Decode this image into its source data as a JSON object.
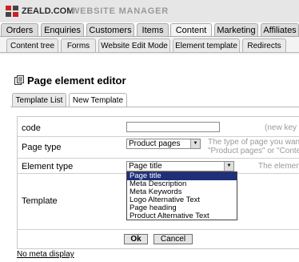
{
  "header": {
    "brand": "ZEALD.COM",
    "product": "WEBSITE MANAGER"
  },
  "main_tabs": [
    {
      "label": "Orders",
      "active": false
    },
    {
      "label": "Enquiries",
      "active": false
    },
    {
      "label": "Customers",
      "active": false
    },
    {
      "label": "Items",
      "active": false
    },
    {
      "label": "Content",
      "active": true
    },
    {
      "label": "Marketing",
      "active": false
    },
    {
      "label": "Affiliates",
      "active": false
    }
  ],
  "sub_tabs": [
    {
      "label": "Content tree"
    },
    {
      "label": "Forms"
    },
    {
      "label": "Website Edit Mode"
    },
    {
      "label": "Element template"
    },
    {
      "label": "Redirects"
    }
  ],
  "page": {
    "title": "Page element editor"
  },
  "template_tabs": [
    {
      "label": "Template List",
      "active": false
    },
    {
      "label": "New Template",
      "active": true
    }
  ],
  "form": {
    "code_label": "code",
    "code_value": "",
    "code_hint": "(new key v",
    "page_type_label": "Page type",
    "page_type_value": "Product pages",
    "page_type_hint_1": "The type of page you want",
    "page_type_hint_2": "\"Product pages\" or \"Conte",
    "element_type_label": "Element type",
    "element_type_value": "Page title",
    "element_type_hint": "The elemen",
    "element_type_options": [
      "Page title",
      "Meta Description",
      "Meta Keywords",
      "Logo Alternative Text",
      "Page heading",
      "Product Alternative Text"
    ],
    "template_label": "Template"
  },
  "buttons": {
    "ok": "Ok",
    "cancel": "Cancel"
  },
  "footer": {
    "no_meta_link": "No meta display"
  },
  "colors": {
    "selected_option_bg": "#1f2f7a",
    "logo_red": "#cc2222"
  }
}
